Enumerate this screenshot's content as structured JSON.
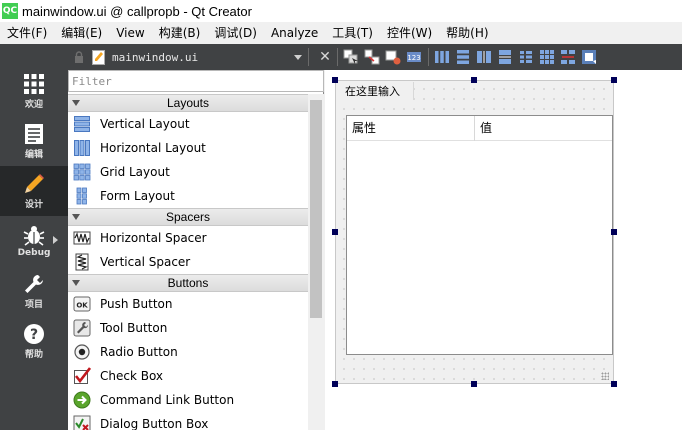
{
  "window": {
    "app_icon_text": "QC",
    "title": "mainwindow.ui @ callpropb - Qt Creator"
  },
  "menubar": {
    "items": [
      "文件(F)",
      "编辑(E)",
      "View",
      "构建(B)",
      "调试(D)",
      "Analyze",
      "工具(T)",
      "控件(W)",
      "帮助(H)"
    ]
  },
  "modes": [
    {
      "label": "欢迎",
      "icon": "grid-icon"
    },
    {
      "label": "编辑",
      "icon": "document-lines-icon"
    },
    {
      "label": "设计",
      "icon": "pencil-icon"
    },
    {
      "label": "Debug",
      "icon": "bug-icon"
    },
    {
      "label": "项目",
      "icon": "wrench-icon"
    },
    {
      "label": "帮助",
      "icon": "question-icon"
    }
  ],
  "doc_toolbar": {
    "file_name": "mainwindow.ui",
    "close_glyph": "✕"
  },
  "widget_box": {
    "filter_placeholder": "Filter",
    "categories": [
      {
        "name": "Layouts",
        "items": [
          "Vertical Layout",
          "Horizontal Layout",
          "Grid Layout",
          "Form Layout"
        ]
      },
      {
        "name": "Spacers",
        "items": [
          "Horizontal Spacer",
          "Vertical Spacer"
        ]
      },
      {
        "name": "Buttons",
        "items": [
          "Push Button",
          "Tool Button",
          "Radio Button",
          "Check Box",
          "Command Link Button",
          "Dialog Button Box"
        ]
      }
    ]
  },
  "form": {
    "menu_placeholder": "在这里输入",
    "table_headers": [
      "属性",
      "值"
    ]
  },
  "colors": {
    "mode_bar": "#404244",
    "mode_active": "#262829",
    "handle": "#000058",
    "qt_green": "#41cd52"
  }
}
